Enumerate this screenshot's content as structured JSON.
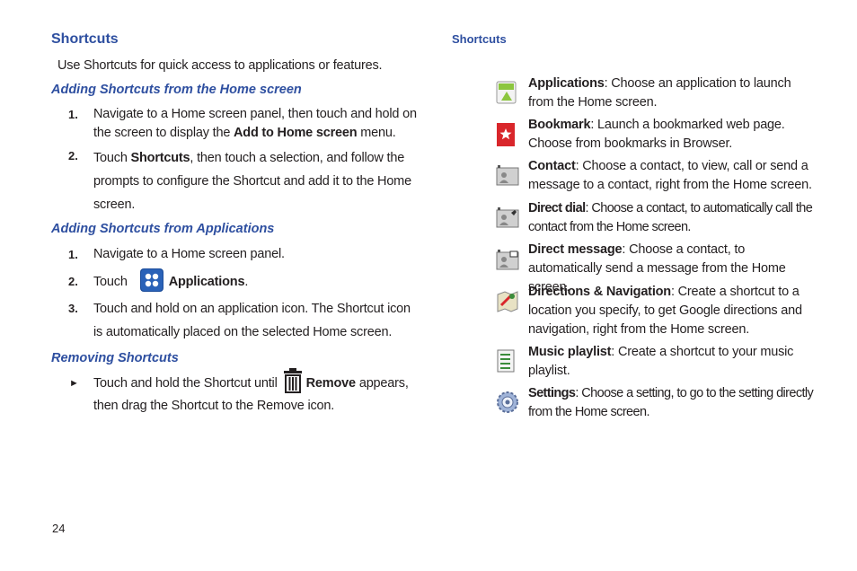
{
  "left": {
    "title": "Shortcuts",
    "intro": "Use Shortcuts for quick access to applications or features.",
    "section1": {
      "heading": "Adding Shortcuts from the Home screen",
      "steps": [
        {
          "num": "1.",
          "pre": "Navigate to a Home screen panel, then touch and hold on the screen to display the ",
          "bold": "Add to Home screen",
          "post": " menu."
        },
        {
          "num": "2.",
          "pre": "Touch ",
          "bold": "Shortcuts",
          "post": ", then touch a selection, and follow the prompts to configure the Shortcut and add it to the Home screen."
        }
      ]
    },
    "section2": {
      "heading": "Adding Shortcuts from Applications",
      "steps": [
        {
          "num": "1.",
          "text": "Navigate to a Home screen panel."
        },
        {
          "num": "2.",
          "pre": "Touch",
          "bold": "Applications",
          "post": "."
        },
        {
          "num": "3.",
          "text": "Touch and hold on an application icon. The Shortcut icon is automatically placed on the selected Home screen."
        }
      ]
    },
    "section3": {
      "heading": "Removing Shortcuts",
      "bullet": "►",
      "pre": "Touch and hold the Shortcut until",
      "bold": "Remove",
      "post1": "appears,",
      "post2": "then drag the Shortcut to the Remove icon."
    }
  },
  "right": {
    "heading": "Shortcuts",
    "items": [
      {
        "bold": "Applications",
        "text": ": Choose an application to launch from the Home screen.",
        "icon": "applications-icon"
      },
      {
        "bold": "Bookmark",
        "text": ": Launch a bookmarked web page. Choose from bookmarks in Browser.",
        "icon": "bookmark-icon"
      },
      {
        "bold": "Contact",
        "text": ": Choose a contact, to view, call or send a message to a contact, right from the Home screen.",
        "icon": "contact-icon"
      },
      {
        "bold": "Direct dial",
        "text": ": Choose a contact, to automatically call the contact from the Home screen.",
        "icon": "direct-dial-icon"
      },
      {
        "bold": "Direct message",
        "text": ": Choose a contact, to automatically send a message from the Home screen.",
        "icon": "direct-message-icon"
      },
      {
        "bold": "Directions & Navigation",
        "text": ": Create a shortcut to a location you specify, to get Google directions and navigation, right from the Home screen.",
        "icon": "directions-navigation-icon"
      },
      {
        "bold": "Music playlist",
        "text": ": Create a shortcut to your music playlist.",
        "icon": "music-playlist-icon"
      },
      {
        "bold": "Settings",
        "text": ": Choose a setting, to go to the setting directly from the Home screen.",
        "icon": "settings-icon"
      }
    ]
  },
  "page_number": "24"
}
